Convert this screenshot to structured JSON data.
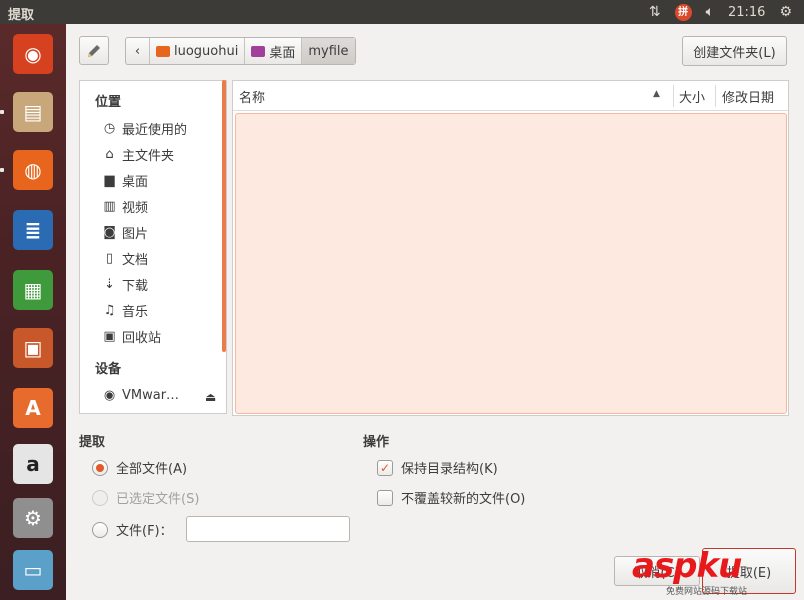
{
  "window": {
    "title": "提取"
  },
  "panel": {
    "clock": "21:16",
    "ime_label": "拼"
  },
  "launcher": {
    "items": [
      {
        "name": "dash-home",
        "glyph": "◉",
        "bg": "#d6421f"
      },
      {
        "name": "file-manager",
        "glyph": "▤",
        "bg": "#c8a77a"
      },
      {
        "name": "firefox",
        "glyph": "◍",
        "bg": "#e8651d"
      },
      {
        "name": "libreoffice-writer",
        "glyph": "≣",
        "bg": "#2a6bb3"
      },
      {
        "name": "libreoffice-calc",
        "glyph": "▦",
        "bg": "#3e9a3b"
      },
      {
        "name": "libreoffice-impress",
        "glyph": "▣",
        "bg": "#c8572a"
      },
      {
        "name": "software-center",
        "glyph": "A",
        "bg": "#e86b2e"
      },
      {
        "name": "amazon",
        "glyph": "a",
        "bg": "#e5e5e5"
      },
      {
        "name": "system-settings",
        "glyph": "⚙",
        "bg": "#8f8f8f"
      },
      {
        "name": "removable-drives",
        "glyph": "▭",
        "bg": "#5aa0c8"
      }
    ]
  },
  "toolbar": {
    "path": [
      {
        "label": "luoguohui",
        "color": "#e8651d"
      },
      {
        "label": "桌面",
        "color": "#a0409a"
      },
      {
        "label": "myfile",
        "color": ""
      }
    ],
    "create_folder": "创建文件夹(L)"
  },
  "sidebar": {
    "places_header": "位置",
    "places": [
      {
        "label": "最近使用的",
        "icon": "clock-icon",
        "glyph": "◷"
      },
      {
        "label": "主文件夹",
        "icon": "home-icon",
        "glyph": "⌂"
      },
      {
        "label": "桌面",
        "icon": "folder-icon",
        "glyph": "▆"
      },
      {
        "label": "视频",
        "icon": "video-icon",
        "glyph": "▥"
      },
      {
        "label": "图片",
        "icon": "camera-icon",
        "glyph": "◙"
      },
      {
        "label": "文档",
        "icon": "document-icon",
        "glyph": "▯"
      },
      {
        "label": "下载",
        "icon": "download-icon",
        "glyph": "⇣"
      },
      {
        "label": "音乐",
        "icon": "music-icon",
        "glyph": "♫"
      },
      {
        "label": "回收站",
        "icon": "trash-icon",
        "glyph": "▣"
      }
    ],
    "devices_header": "设备",
    "devices": [
      {
        "label": "VMwar…",
        "icon": "disc-icon",
        "glyph": "◉"
      }
    ]
  },
  "filelist": {
    "col_name": "名称",
    "col_size": "大小",
    "col_modified": "修改日期"
  },
  "extract": {
    "title": "提取",
    "all_files": "全部文件(A)",
    "selected_files": "已选定文件(S)",
    "files": "文件(F)：",
    "files_value": ""
  },
  "actions": {
    "title": "操作",
    "keep_structure": "保持目录结构(K)",
    "no_overwrite": "不覆盖较新的文件(O)"
  },
  "buttons": {
    "cancel": "取消(C)",
    "extract": "提取(E)"
  },
  "watermark": {
    "brand": "aspku",
    "sub": "免费网站源码下载站"
  }
}
